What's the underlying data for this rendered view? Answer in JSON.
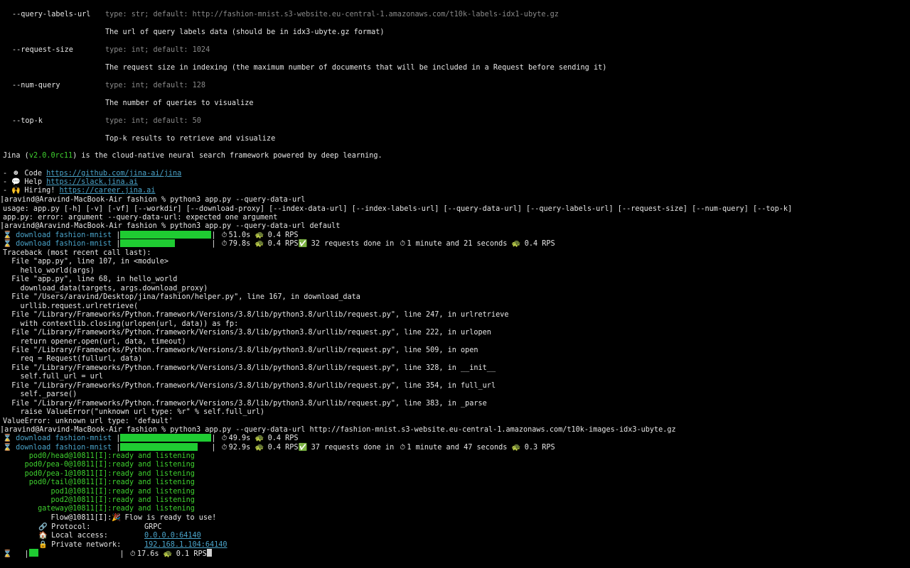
{
  "help": [
    {
      "flag": "--query-labels-url",
      "meta": "type: str; default: http://fashion-mnist.s3-website.eu-central-1.amazonaws.com/t10k-labels-idx1-ubyte.gz",
      "desc": "The url of query labels data (should be in idx3-ubyte.gz format)"
    },
    {
      "flag": "--request-size",
      "meta": "type: int; default: 1024",
      "desc": "The request size in indexing (the maximum number of documents that will be included in a Request before sending it)"
    },
    {
      "flag": "--num-query",
      "meta": "type: int; default: 128",
      "desc": "The number of queries to visualize"
    },
    {
      "flag": "--top-k",
      "meta": "type: int; default: 50",
      "desc": "Top-k results to retrieve and visualize"
    }
  ],
  "jina_line": {
    "pre": "Jina (",
    "version": "v2.0.0rc11",
    "post": ") is the cloud-native neural search framework powered by deep learning."
  },
  "links": [
    {
      "label": "Code ",
      "url": "https://github.com/jina-ai/jina"
    },
    {
      "label": "Help ",
      "url": "https://slack.jina.ai"
    },
    {
      "label": "Hiring! ",
      "url": "https://career.jina.ai"
    }
  ],
  "prompt1": "aravind@Aravind-MacBook-Air fashion % python3 app.py --query-data-url",
  "usage": "usage: app.py [-h] [-v] [-vf] [--workdir] [--download-proxy] [--index-data-url] [--index-labels-url] [--query-data-url] [--query-labels-url] [--request-size] [--num-query] [--top-k]",
  "usage_error": "app.py: error: argument --query-data-url: expected one argument",
  "prompt2": "aravind@Aravind-MacBook-Air fashion % python3 app.py --query-data-url default",
  "download1": [
    {
      "label": "download fashion-mnist",
      "fill": 1.0,
      "time": "51.0s",
      "rps": "0.4 RPS",
      "extra": ""
    },
    {
      "label": "download fashion-mnist",
      "fill": 0.6,
      "time": "79.8s",
      "rps": "0.4 RPS",
      "extra": " 32 requests done in ",
      "extra_time": "1 minute and 21 seconds",
      "extra_rps": "0.4 RPS"
    }
  ],
  "traceback": [
    "Traceback (most recent call last):",
    "  File \"app.py\", line 107, in <module>",
    "    hello_world(args)",
    "  File \"app.py\", line 68, in hello_world",
    "    download_data(targets, args.download_proxy)",
    "  File \"/Users/aravind/Desktop/jina/fashion/helper.py\", line 167, in download_data",
    "    urllib.request.urlretrieve(",
    "  File \"/Library/Frameworks/Python.framework/Versions/3.8/lib/python3.8/urllib/request.py\", line 247, in urlretrieve",
    "    with contextlib.closing(urlopen(url, data)) as fp:",
    "  File \"/Library/Frameworks/Python.framework/Versions/3.8/lib/python3.8/urllib/request.py\", line 222, in urlopen",
    "    return opener.open(url, data, timeout)",
    "  File \"/Library/Frameworks/Python.framework/Versions/3.8/lib/python3.8/urllib/request.py\", line 509, in open",
    "    req = Request(fullurl, data)",
    "  File \"/Library/Frameworks/Python.framework/Versions/3.8/lib/python3.8/urllib/request.py\", line 328, in __init__",
    "    self.full_url = url",
    "  File \"/Library/Frameworks/Python.framework/Versions/3.8/lib/python3.8/urllib/request.py\", line 354, in full_url",
    "    self._parse()",
    "  File \"/Library/Frameworks/Python.framework/Versions/3.8/lib/python3.8/urllib/request.py\", line 383, in _parse",
    "    raise ValueError(\"unknown url type: %r\" % self.full_url)",
    "ValueError: unknown url type: 'default'"
  ],
  "prompt3": "aravind@Aravind-MacBook-Air fashion % python3 app.py --query-data-url http://fashion-mnist.s3-website.eu-central-1.amazonaws.com/t10k-images-idx3-ubyte.gz",
  "download2": [
    {
      "label": "download fashion-mnist",
      "fill": 1.0,
      "time": "49.9s",
      "rps": "0.4 RPS",
      "extra": ""
    },
    {
      "label": "download fashion-mnist",
      "fill": 0.85,
      "time": "92.9s",
      "rps": "0.4 RPS",
      "extra": " 37 requests done in ",
      "extra_time": "1 minute and 47 seconds",
      "extra_rps": "0.3 RPS"
    }
  ],
  "pods": [
    "      pod0/head@10811[I]:ready and listening",
    "     pod0/pea-0@10811[I]:ready and listening",
    "     pod0/pea-1@10811[I]:ready and listening",
    "      pod0/tail@10811[I]:ready and listening",
    "           pod1@10811[I]:ready and listening",
    "           pod2@10811[I]:ready and listening",
    "        gateway@10811[I]:ready and listening"
  ],
  "flow_ready": {
    "pre": "           Flow@10811[I]:",
    "msg": " Flow is ready to use!"
  },
  "flow_info": [
    {
      "label": "Protocol:",
      "value": "GRPC",
      "is_link": false
    },
    {
      "label": "Local access:",
      "value": "0.0.0.0:64140",
      "is_link": true
    },
    {
      "label": "Private network:",
      "value": "192.168.1.104:64140",
      "is_link": true
    }
  ],
  "final_progress": {
    "fill": 0.1,
    "time": "17.6s",
    "rps": "0.1 RPS"
  },
  "colors": {
    "background": "#000000",
    "text": "#e6e6e6",
    "gray": "#8a8a8a",
    "green": "#3fd12f",
    "bar": "#1fcc32",
    "link": "#4aa3c9"
  }
}
